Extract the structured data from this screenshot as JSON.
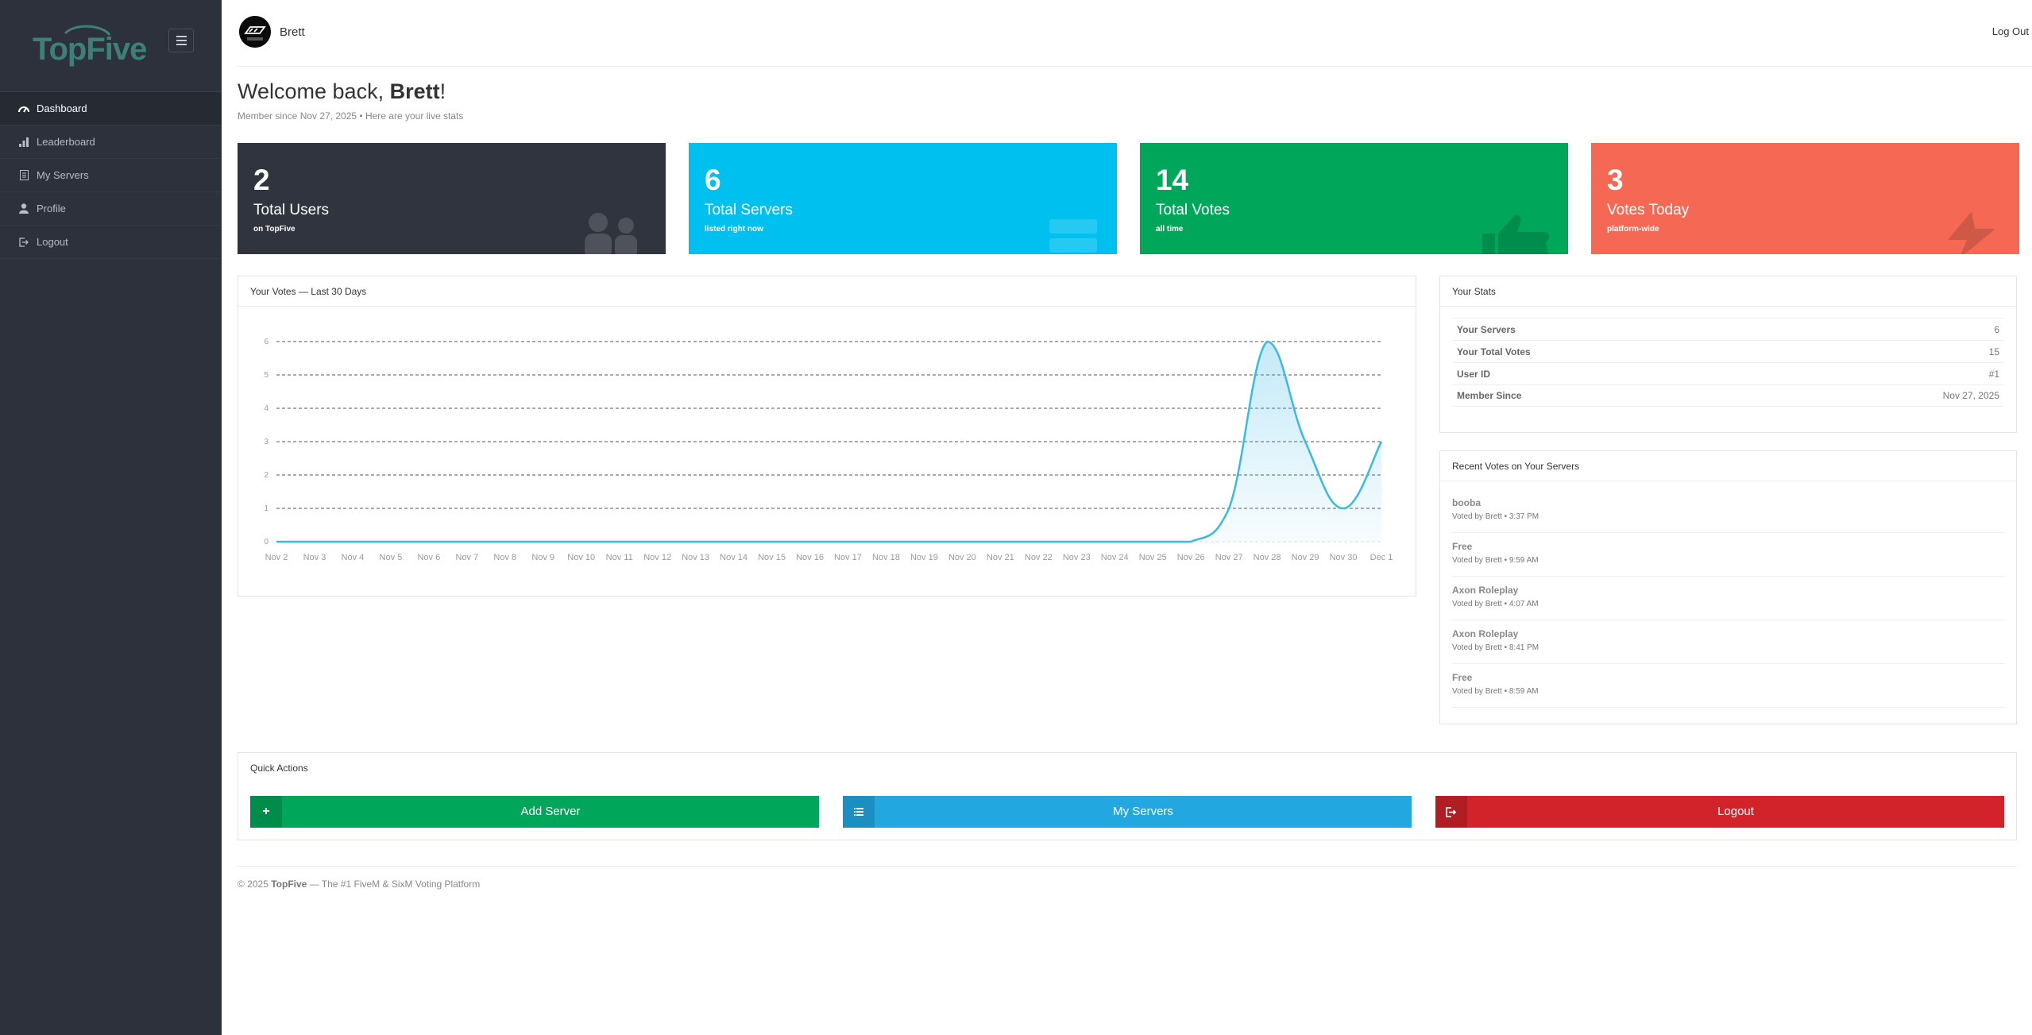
{
  "brand": {
    "logo_text": "TopFive",
    "accent": "#3f7f7a"
  },
  "sidebar": {
    "items": [
      {
        "label": "Dashboard",
        "icon": "speedometer-icon",
        "active": true
      },
      {
        "label": "Leaderboard",
        "icon": "bar-chart-icon"
      },
      {
        "label": "My Servers",
        "icon": "server-list-icon"
      },
      {
        "label": "Profile",
        "icon": "user-icon"
      },
      {
        "label": "Logout",
        "icon": "sign-out-icon"
      }
    ]
  },
  "header": {
    "username": "Brett",
    "logout_label": "Log Out"
  },
  "welcome": {
    "prefix": "Welcome back, ",
    "name": "Brett",
    "suffix": "!",
    "subtitle": "Member since Nov 27, 2025 • Here are your live stats"
  },
  "stat_cards": [
    {
      "value": "2",
      "label": "Total Users",
      "sub": "on TopFive",
      "color": "#30343e",
      "icon": "users-icon"
    },
    {
      "value": "6",
      "label": "Total Servers",
      "sub": "listed right now",
      "color": "#00c0ef",
      "icon": "server-icon"
    },
    {
      "value": "14",
      "label": "Total Votes",
      "sub": "all time",
      "color": "#00a65a",
      "icon": "thumbs-up-icon"
    },
    {
      "value": "3",
      "label": "Votes Today",
      "sub": "platform-wide",
      "color": "#f56954",
      "icon": "bolt-icon"
    }
  ],
  "chart_panel": {
    "title": "Your Votes — Last 30 Days"
  },
  "chart_data": {
    "type": "line",
    "x": [
      "Nov 2",
      "Nov 3",
      "Nov 4",
      "Nov 5",
      "Nov 6",
      "Nov 7",
      "Nov 8",
      "Nov 9",
      "Nov 10",
      "Nov 11",
      "Nov 12",
      "Nov 13",
      "Nov 14",
      "Nov 15",
      "Nov 16",
      "Nov 17",
      "Nov 18",
      "Nov 19",
      "Nov 20",
      "Nov 21",
      "Nov 22",
      "Nov 23",
      "Nov 24",
      "Nov 25",
      "Nov 26",
      "Nov 27",
      "Nov 28",
      "Nov 29",
      "Nov 30",
      "Dec 1"
    ],
    "series": [
      {
        "values": [
          0,
          0,
          0,
          0,
          0,
          0,
          0,
          0,
          0,
          0,
          0,
          0,
          0,
          0,
          0,
          0,
          0,
          0,
          0,
          0,
          0,
          0,
          0,
          0,
          0,
          1,
          6,
          3,
          1,
          3
        ],
        "color": "#3ab8e6"
      }
    ],
    "y_ticks": [
      "0",
      "1",
      "2",
      "3",
      "4",
      "5",
      "6"
    ],
    "ylim": [
      0,
      6
    ],
    "grid": true
  },
  "your_stats": {
    "title": "Your Stats",
    "rows": [
      {
        "key": "Your Servers",
        "value": "6"
      },
      {
        "key": "Your Total Votes",
        "value": "15"
      },
      {
        "key": "User ID",
        "value": "#1"
      },
      {
        "key": "Member Since",
        "value": "Nov 27, 2025"
      }
    ]
  },
  "recent_votes": {
    "title": "Recent Votes on Your Servers",
    "items": [
      {
        "server": "booba",
        "meta": "Voted by Brett • 3:37 PM"
      },
      {
        "server": "Free",
        "meta": "Voted by Brett • 9:59 AM"
      },
      {
        "server": "Axon Roleplay",
        "meta": "Voted by Brett • 4:07 AM"
      },
      {
        "server": "Axon Roleplay",
        "meta": "Voted by Brett • 8:41 PM"
      },
      {
        "server": "Free",
        "meta": "Voted by Brett • 8:59 AM"
      }
    ]
  },
  "quick_actions": {
    "title": "Quick Actions",
    "buttons": [
      {
        "label": "Add Server",
        "icon_glyph": "+",
        "color": "#00a65a",
        "icon_bg": "#008d4c"
      },
      {
        "label": "My Servers",
        "icon_glyph": "≡",
        "color": "#22a7e0",
        "icon_bg": "#1b8ec2"
      },
      {
        "label": "Logout",
        "icon_glyph": "⇥",
        "color": "#d2232a",
        "icon_bg": "#b01d23"
      }
    ]
  },
  "footer": {
    "prefix": "© 2025 ",
    "brand": "TopFive",
    "suffix": " — The #1 FiveM & SixM Voting Platform"
  }
}
